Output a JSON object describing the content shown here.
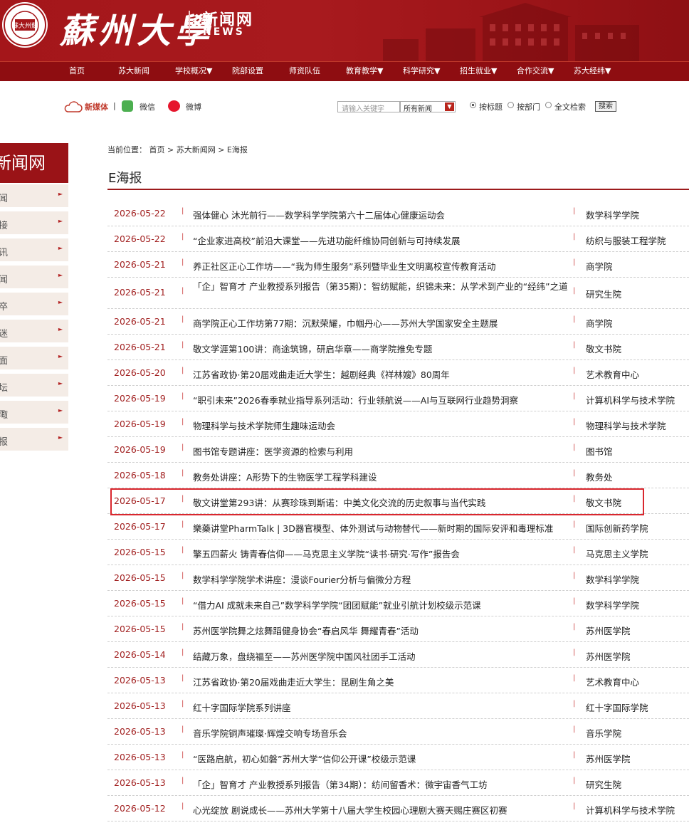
{
  "header": {
    "seal_text": "蘇大州蘇",
    "brand": "蘇州大學",
    "news_cn": "新闻网",
    "news_en": "NEWS"
  },
  "nav": [
    {
      "label": "首页"
    },
    {
      "label": "苏大新闻"
    },
    {
      "label": "学校概况▼"
    },
    {
      "label": "院部设置"
    },
    {
      "label": "师资队伍"
    },
    {
      "label": "教育教学▼"
    },
    {
      "label": "科学研究▼"
    },
    {
      "label": "招生就业▼"
    },
    {
      "label": "合作交流▼"
    },
    {
      "label": "苏大经纬▼"
    }
  ],
  "toolbar": {
    "new_media": "新媒体",
    "sep": "|",
    "wechat": "微信",
    "weibo": "微博",
    "search_placeholder": "请输入关键字",
    "select_value": "所有新闻",
    "by_title": "按标题",
    "by_dept": "按部门",
    "full_text": "全文检索",
    "search_btn": "搜索"
  },
  "sidebar": {
    "title": "新闻网",
    "items": [
      "闻",
      "接",
      "讯",
      "闻",
      "卒",
      "迷",
      "面",
      "坛",
      "陬",
      "报"
    ]
  },
  "breadcrumb": "当前位置： 首页 > 苏大新闻网 > E海报",
  "page_title": "E海报",
  "rows": [
    {
      "date": "2026-05-22",
      "title": "强体健心 沐光前行——数学科学学院第六十二届体心健康运动会",
      "unit": "数学科学学院"
    },
    {
      "date": "2026-05-22",
      "title": "“企业家进高校”前沿大课堂——先进功能纤维协同创新与可持续发展",
      "unit": "纺织与服装工程学院"
    },
    {
      "date": "2026-05-21",
      "title": "养正社区正心工作坊——“我为师生服务”系列暨毕业生文明离校宣传教育活动",
      "unit": "商学院"
    },
    {
      "date": "2026-05-21",
      "title": "「企」智育才 产业教授系列报告（第35期）：智纺赋能，织锦未来：从学术到产业的“经纬”之道",
      "unit": "研究生院"
    },
    {
      "date": "2026-05-21",
      "title": "商学院正心工作坊第77期：沉默荣耀，巾帼丹心——苏州大学国家安全主题展",
      "unit": "商学院"
    },
    {
      "date": "2026-05-21",
      "title": "敬文学涯第100讲：商途筑锦，研启华章——商学院推免专题",
      "unit": "敬文书院"
    },
    {
      "date": "2026-05-20",
      "title": "江苏省政协·第20届戏曲走近大学生：越剧经典《祥林嫂》80周年",
      "unit": "艺术教育中心"
    },
    {
      "date": "2026-05-19",
      "title": "“职引未来”2026春季就业指导系列活动：行业领航说——AI与互联网行业趋势洞察",
      "unit": "计算机科学与技术学院"
    },
    {
      "date": "2026-05-19",
      "title": "物理科学与技术学院师生趣味运动会",
      "unit": "物理科学与技术学院"
    },
    {
      "date": "2026-05-19",
      "title": "图书馆专题讲座：医学资源的检索与利用",
      "unit": "图书馆"
    },
    {
      "date": "2026-05-18",
      "title": "教务处讲座：A形势下的生物医学工程学科建设",
      "unit": "教务处"
    },
    {
      "date": "2026-05-17",
      "title": "敬文讲堂第293讲：从赛珍珠到斯诺：中美文化交流的历史叙事与当代实践",
      "unit": "敬文书院"
    },
    {
      "date": "2026-05-17",
      "title": "樂藥讲堂PharmTalk | 3D器官模型、体外测试与动物替代——新时期的国际安评和毒理标准",
      "unit": "国际创新药学院"
    },
    {
      "date": "2026-05-15",
      "title": "擎五四薪火 铸青春信仰——马克思主义学院“读书·研究·写作”报告会",
      "unit": "马克思主义学院"
    },
    {
      "date": "2026-05-15",
      "title": "数学科学学院学术讲座：漫谈Fourier分析与偏微分方程",
      "unit": "数学科学学院"
    },
    {
      "date": "2026-05-15",
      "title": "“借力AI 成就未来自己”数学科学学院“团团赋能”就业引航计划校级示范课",
      "unit": "数学科学学院"
    },
    {
      "date": "2026-05-15",
      "title": "苏州医学院舞之炫舞蹈健身协会“春启风华 舞耀青春”活动",
      "unit": "苏州医学院"
    },
    {
      "date": "2026-05-14",
      "title": "结藏万象，盘绕福至——苏州医学院中国风社团手工活动",
      "unit": "苏州医学院"
    },
    {
      "date": "2026-05-13",
      "title": "江苏省政协·第20届戏曲走近大学生：昆剧生角之美",
      "unit": "艺术教育中心"
    },
    {
      "date": "2026-05-13",
      "title": "红十字国际学院系列讲座",
      "unit": "红十字国际学院"
    },
    {
      "date": "2026-05-13",
      "title": "音乐学院铜声璀璨·辉煌交响专场音乐会",
      "unit": "音乐学院"
    },
    {
      "date": "2026-05-13",
      "title": "“医路启航，初心如磐”苏州大学“信仰公开课”校级示范课",
      "unit": "苏州医学院"
    },
    {
      "date": "2026-05-13",
      "title": "「企」智育才 产业教授系列报告（第34期）：纺间留香术：微宇宙香气工坊",
      "unit": "研究生院"
    },
    {
      "date": "2026-05-12",
      "title": "心光绽放 剧说成长——苏州大学第十八届大学生校园心理剧大赛天赐庄赛区初赛",
      "unit": "计算机科学与技术学院"
    }
  ],
  "row_sep": "|",
  "colors": {
    "brand_red": "#a4161a",
    "nav_red": "#8e0d11",
    "date_red": "#a11f1f",
    "highlight": "#d9272e"
  }
}
